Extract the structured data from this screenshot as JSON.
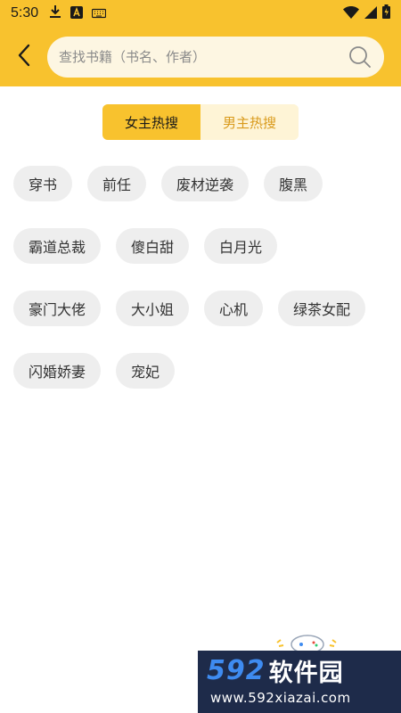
{
  "status_bar": {
    "time": "5:30",
    "left_icons": [
      "download-icon",
      "a-badge-icon",
      "keyboard-icon"
    ],
    "right_icons": [
      "wifi-icon",
      "signal-icon",
      "battery-icon"
    ]
  },
  "header": {
    "back_icon": "chevron-left-icon",
    "search": {
      "placeholder": "查找书籍（书名、作者）",
      "value": ""
    },
    "search_icon": "search-icon"
  },
  "tabs": [
    {
      "label": "女主热搜",
      "active": true
    },
    {
      "label": "男主热搜",
      "active": false
    }
  ],
  "tag_rows": [
    [
      "穿书",
      "前任",
      "废材逆袭",
      "腹黑"
    ],
    [
      "霸道总裁",
      "傻白甜",
      "白月光"
    ],
    [
      "豪门大佬",
      "大小姐",
      "心机",
      "绿茶女配"
    ],
    [
      "闪婚娇妻",
      "宠妃"
    ]
  ],
  "watermark": {
    "number": "592",
    "brand": "软件园",
    "url": "www.592xiazai.com"
  },
  "colors": {
    "accent": "#F8C22E",
    "tab_inactive_bg": "#FEF4D6",
    "tab_inactive_text": "#D99A1B",
    "tag_bg": "#EEEEEE",
    "search_bg": "#FDF6E2"
  }
}
